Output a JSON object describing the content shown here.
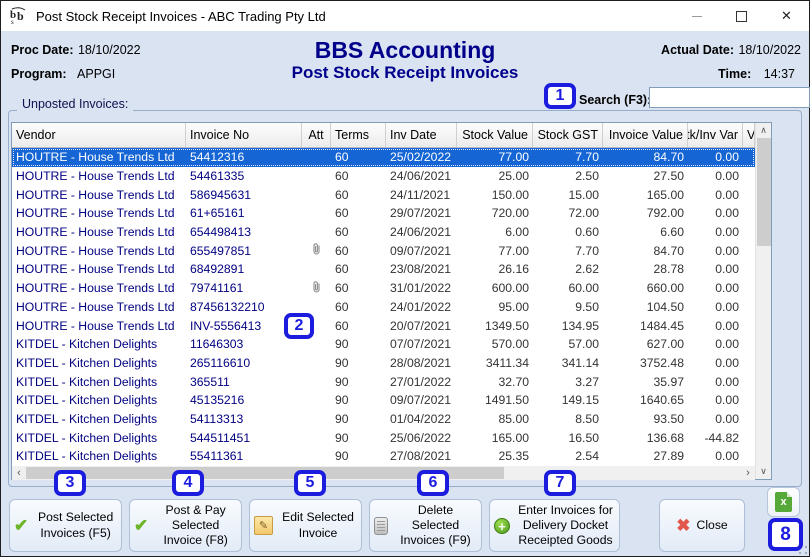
{
  "window": {
    "title": "Post Stock Receipt Invoices - ABC Trading Pty Ltd",
    "controls": {
      "close_glyph": "✕"
    }
  },
  "header": {
    "proc_date_label": "Proc Date:",
    "proc_date": "18/10/2022",
    "program_label": "Program:",
    "program": "APPGI",
    "actual_date_label": "Actual Date:",
    "actual_date": "18/10/2022",
    "time_label": "Time:",
    "time": "14:37",
    "app_title": "BBS Accounting",
    "screen_title": "Post Stock Receipt Invoices"
  },
  "search": {
    "label": "Search (F3):",
    "value": ""
  },
  "unposted": {
    "group_label": "Unposted Invoices:"
  },
  "table": {
    "columns": [
      "Vendor",
      "Invoice No",
      "Att",
      "Terms",
      "Inv Date",
      "Stock Value",
      "Stock GST",
      "Invoice Value",
      "Stk/Inv Var",
      "Va"
    ],
    "rows": [
      {
        "vendor": "HOUTRE - House Trends Ltd",
        "invoice_no": "54412316",
        "att": false,
        "terms": "60",
        "inv_date": "25/02/2022",
        "stock_value": "77.00",
        "stock_gst": "7.70",
        "invoice_value": "84.70",
        "stk_inv_var": "0.00",
        "selected": true
      },
      {
        "vendor": "HOUTRE - House Trends Ltd",
        "invoice_no": "54461335",
        "att": false,
        "terms": "60",
        "inv_date": "24/06/2021",
        "stock_value": "25.00",
        "stock_gst": "2.50",
        "invoice_value": "27.50",
        "stk_inv_var": "0.00",
        "selected": false
      },
      {
        "vendor": "HOUTRE - House Trends Ltd",
        "invoice_no": "586945631",
        "att": false,
        "terms": "60",
        "inv_date": "24/11/2021",
        "stock_value": "150.00",
        "stock_gst": "15.00",
        "invoice_value": "165.00",
        "stk_inv_var": "0.00",
        "selected": false
      },
      {
        "vendor": "HOUTRE - House Trends Ltd",
        "invoice_no": "61+65161",
        "att": false,
        "terms": "60",
        "inv_date": "29/07/2021",
        "stock_value": "720.00",
        "stock_gst": "72.00",
        "invoice_value": "792.00",
        "stk_inv_var": "0.00",
        "selected": false
      },
      {
        "vendor": "HOUTRE - House Trends Ltd",
        "invoice_no": "654498413",
        "att": false,
        "terms": "60",
        "inv_date": "24/06/2021",
        "stock_value": "6.00",
        "stock_gst": "0.60",
        "invoice_value": "6.60",
        "stk_inv_var": "0.00",
        "selected": false
      },
      {
        "vendor": "HOUTRE - House Trends Ltd",
        "invoice_no": "655497851",
        "att": true,
        "terms": "60",
        "inv_date": "09/07/2021",
        "stock_value": "77.00",
        "stock_gst": "7.70",
        "invoice_value": "84.70",
        "stk_inv_var": "0.00",
        "selected": false
      },
      {
        "vendor": "HOUTRE - House Trends Ltd",
        "invoice_no": "68492891",
        "att": false,
        "terms": "60",
        "inv_date": "23/08/2021",
        "stock_value": "26.16",
        "stock_gst": "2.62",
        "invoice_value": "28.78",
        "stk_inv_var": "0.00",
        "selected": false
      },
      {
        "vendor": "HOUTRE - House Trends Ltd",
        "invoice_no": "79741161",
        "att": true,
        "terms": "60",
        "inv_date": "31/01/2022",
        "stock_value": "600.00",
        "stock_gst": "60.00",
        "invoice_value": "660.00",
        "stk_inv_var": "0.00",
        "selected": false
      },
      {
        "vendor": "HOUTRE - House Trends Ltd",
        "invoice_no": "87456132210",
        "att": false,
        "terms": "60",
        "inv_date": "24/01/2022",
        "stock_value": "95.00",
        "stock_gst": "9.50",
        "invoice_value": "104.50",
        "stk_inv_var": "0.00",
        "selected": false
      },
      {
        "vendor": "HOUTRE - House Trends Ltd",
        "invoice_no": "INV-5556413",
        "att": false,
        "terms": "60",
        "inv_date": "20/07/2021",
        "stock_value": "1349.50",
        "stock_gst": "134.95",
        "invoice_value": "1484.45",
        "stk_inv_var": "0.00",
        "selected": false
      },
      {
        "vendor": "KITDEL - Kitchen Delights",
        "invoice_no": "11646303",
        "att": false,
        "terms": "90",
        "inv_date": "07/07/2021",
        "stock_value": "570.00",
        "stock_gst": "57.00",
        "invoice_value": "627.00",
        "stk_inv_var": "0.00",
        "selected": false
      },
      {
        "vendor": "KITDEL - Kitchen Delights",
        "invoice_no": "265116610",
        "att": false,
        "terms": "90",
        "inv_date": "28/08/2021",
        "stock_value": "3411.34",
        "stock_gst": "341.14",
        "invoice_value": "3752.48",
        "stk_inv_var": "0.00",
        "selected": false
      },
      {
        "vendor": "KITDEL - Kitchen Delights",
        "invoice_no": "365511",
        "att": false,
        "terms": "90",
        "inv_date": "27/01/2022",
        "stock_value": "32.70",
        "stock_gst": "3.27",
        "invoice_value": "35.97",
        "stk_inv_var": "0.00",
        "selected": false
      },
      {
        "vendor": "KITDEL - Kitchen Delights",
        "invoice_no": "45135216",
        "att": false,
        "terms": "90",
        "inv_date": "09/07/2021",
        "stock_value": "1491.50",
        "stock_gst": "149.15",
        "invoice_value": "1640.65",
        "stk_inv_var": "0.00",
        "selected": false
      },
      {
        "vendor": "KITDEL - Kitchen Delights",
        "invoice_no": "54113313",
        "att": false,
        "terms": "90",
        "inv_date": "01/04/2022",
        "stock_value": "85.00",
        "stock_gst": "8.50",
        "invoice_value": "93.50",
        "stk_inv_var": "0.00",
        "selected": false
      },
      {
        "vendor": "KITDEL - Kitchen Delights",
        "invoice_no": "544511451",
        "att": false,
        "terms": "90",
        "inv_date": "25/06/2022",
        "stock_value": "165.00",
        "stock_gst": "16.50",
        "invoice_value": "136.68",
        "stk_inv_var": "-44.82",
        "selected": false
      },
      {
        "vendor": "KITDEL - Kitchen Delights",
        "invoice_no": "55411361",
        "att": false,
        "terms": "90",
        "inv_date": "27/08/2021",
        "stock_value": "25.35",
        "stock_gst": "2.54",
        "invoice_value": "27.89",
        "stk_inv_var": "0.00",
        "selected": false
      }
    ]
  },
  "buttons": [
    {
      "label": "Post Selected Invoices (F5)",
      "icon": "check-icon"
    },
    {
      "label": "Post & Pay Selected Invoice (F8)",
      "icon": "check-icon"
    },
    {
      "label": "Edit Selected Invoice",
      "icon": "edit-icon"
    },
    {
      "label": "Delete Selected Invoices (F9)",
      "icon": "bin-icon"
    },
    {
      "label": "Enter Invoices for Delivery Docket Receipted Goods",
      "icon": "plus-icon"
    },
    {
      "label": "Close",
      "icon": "close-x-icon"
    }
  ],
  "excel_button": {
    "icon": "excel-export-icon"
  },
  "annotations": [
    "1",
    "2",
    "3",
    "4",
    "5",
    "6",
    "7",
    "8"
  ],
  "colors": {
    "background": "#d9e3f2",
    "title_navy": "#00008b",
    "selection_blue": "#1565d4",
    "annotation_blue": "#1c1cdf",
    "row_text": "#333333",
    "row_navy": "#000080"
  }
}
